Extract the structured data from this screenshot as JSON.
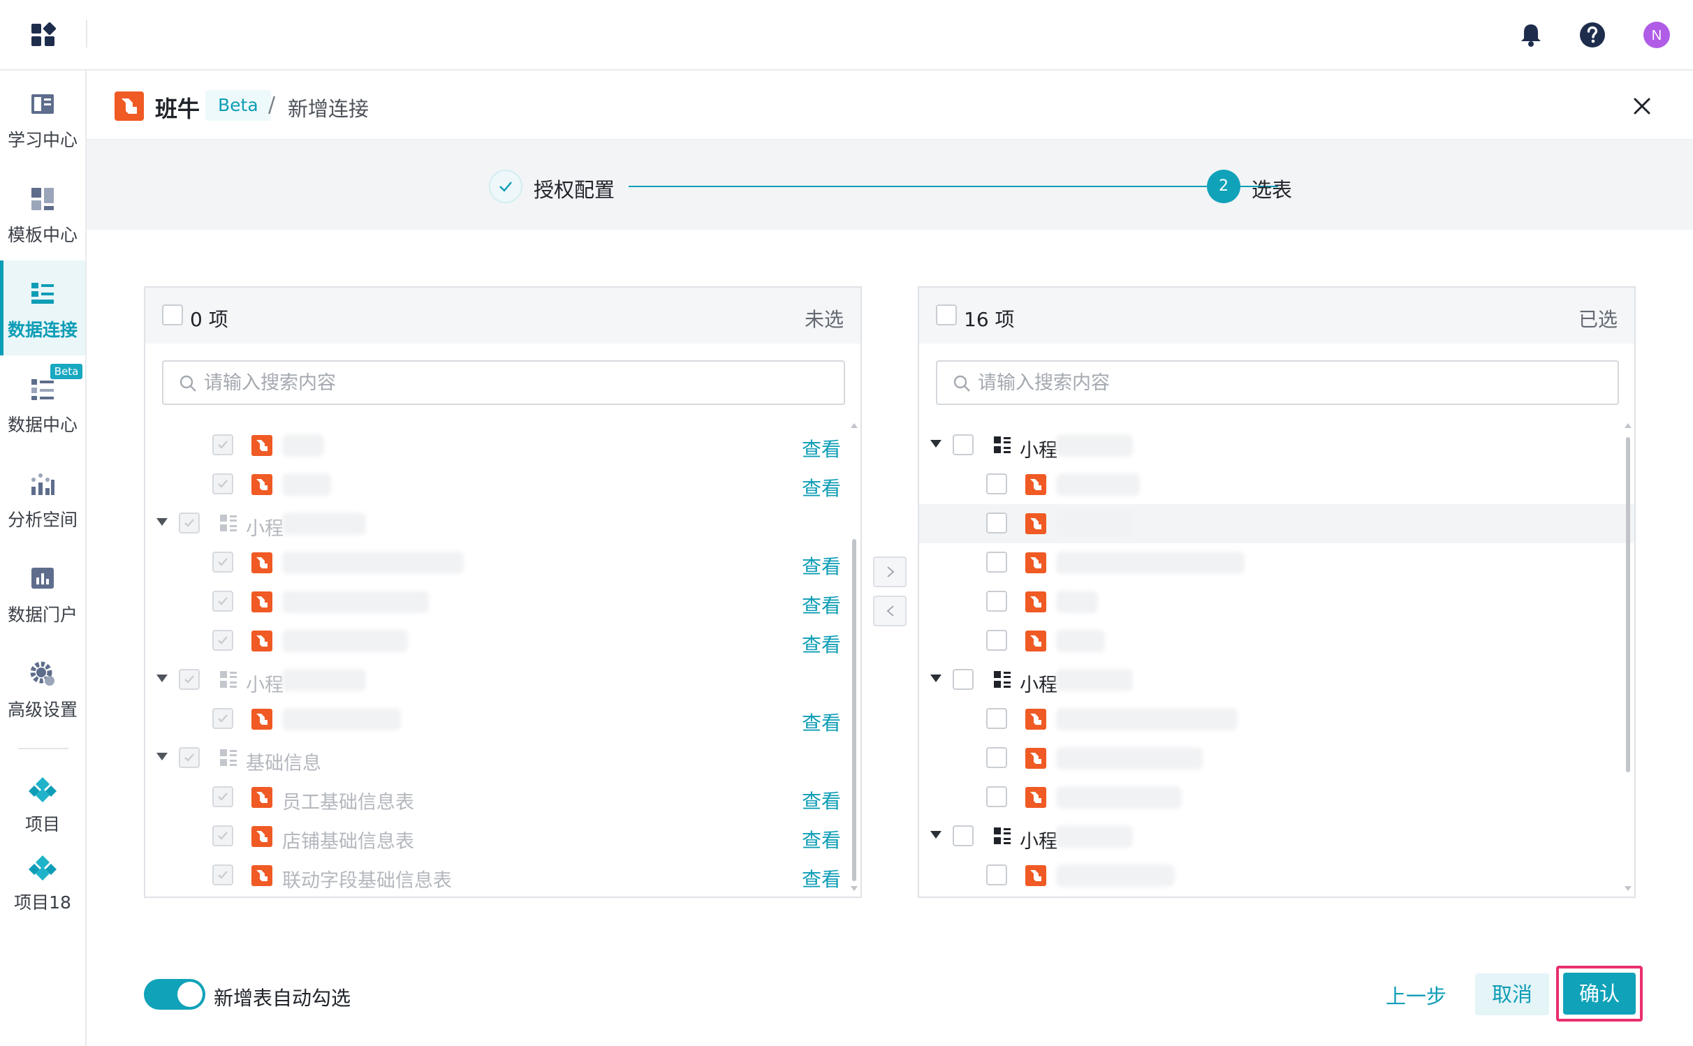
{
  "topbar": {
    "icons": [
      "apps-grid-icon",
      "bell-icon",
      "help-icon",
      "avatar"
    ],
    "avatar_letter": "N",
    "avatar_color": "#b05ce6"
  },
  "sidebar": {
    "items": [
      {
        "label": "学习中心",
        "icon": "book-icon"
      },
      {
        "label": "模板中心",
        "icon": "template-icon"
      },
      {
        "label": "数据连接",
        "icon": "data-connect-icon",
        "active": true
      },
      {
        "label": "数据中心",
        "icon": "data-center-icon",
        "badge": "Beta"
      },
      {
        "label": "分析空间",
        "icon": "analysis-icon"
      },
      {
        "label": "数据门户",
        "icon": "portal-icon"
      },
      {
        "label": "高级设置",
        "icon": "gear-icon"
      },
      {
        "label": "项目",
        "icon": "project-icon"
      },
      {
        "label": "项目18",
        "icon": "project-icon"
      }
    ]
  },
  "header": {
    "brand": "班牛",
    "beta": "Beta",
    "separator": "/",
    "page": "新增连接"
  },
  "steps": {
    "step1": "授权配置",
    "step2_num": "2",
    "step2": "选表"
  },
  "left_panel": {
    "count": "0 项",
    "tag": "未选",
    "search_placeholder": "请输入搜索内容",
    "view_label": "查看",
    "group_mini": "小程",
    "group_basic": "基础信息",
    "tables": [
      "员工基础信息表",
      "店铺基础信息表",
      "联动字段基础信息表"
    ]
  },
  "right_panel": {
    "count": "16 项",
    "tag": "已选",
    "search_placeholder": "请输入搜索内容",
    "group_mini": "小程"
  },
  "transfer": {
    "to_right": ">",
    "to_left": "<"
  },
  "footer": {
    "toggle_label": "新增表自动勾选",
    "toggle_on": true,
    "prev": "上一步",
    "cancel": "取消",
    "confirm": "确认"
  },
  "colors": {
    "accent": "#10a2b9",
    "brand_orange": "#f05a24",
    "highlight": "#e8306f"
  }
}
